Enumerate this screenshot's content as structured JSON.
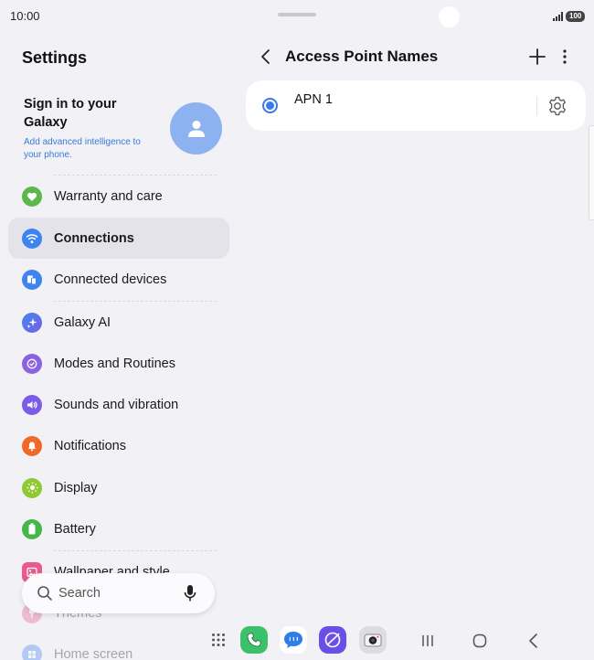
{
  "status_bar": {
    "time": "10:00",
    "battery": "100"
  },
  "settings": {
    "title": "Settings",
    "account": {
      "title": "Sign in to your Galaxy",
      "subtitle": "Add advanced intelligence to your phone."
    },
    "items": [
      {
        "label": "Warranty and care",
        "icon": "heart-shield-icon",
        "color": "#5cb84a"
      },
      {
        "label": "Connections",
        "icon": "wifi-icon",
        "color": "#3d84f0",
        "active": true
      },
      {
        "label": "Connected devices",
        "icon": "devices-icon",
        "color": "#3d84f0"
      },
      {
        "label": "Galaxy AI",
        "icon": "sparkle-icon",
        "color": "#4a6ff0"
      },
      {
        "label": "Modes and Routines",
        "icon": "check-circle-icon",
        "color": "#8a63e0"
      },
      {
        "label": "Sounds and vibration",
        "icon": "speaker-icon",
        "color": "#7b5ce6"
      },
      {
        "label": "Notifications",
        "icon": "bell-icon",
        "color": "#f0682a"
      },
      {
        "label": "Display",
        "icon": "sun-icon",
        "color": "#8fc933"
      },
      {
        "label": "Battery",
        "icon": "battery-icon",
        "color": "#45b649"
      },
      {
        "label": "Wallpaper and style",
        "icon": "image-icon",
        "color": "#e85a8a"
      },
      {
        "label": "Themes",
        "icon": "themes-icon",
        "color": "#e85a8a"
      },
      {
        "label": "Home screen",
        "icon": "home-screen-icon",
        "color": "#3d84f0"
      }
    ],
    "search": {
      "label": "Search"
    }
  },
  "apn": {
    "title": "Access Point Names",
    "entries": [
      {
        "name": "APN 1",
        "selected": true
      }
    ]
  },
  "taskbar": {
    "apps": [
      {
        "name": "Phone",
        "icon": "phone-icon",
        "color": "#3bc16a"
      },
      {
        "name": "Messages",
        "icon": "messages-icon",
        "color": "#2f7de8"
      },
      {
        "name": "Internet",
        "icon": "internet-icon",
        "color": "#6a4ee8"
      },
      {
        "name": "Camera",
        "icon": "camera-icon",
        "color": "#c9c9cf"
      }
    ]
  }
}
